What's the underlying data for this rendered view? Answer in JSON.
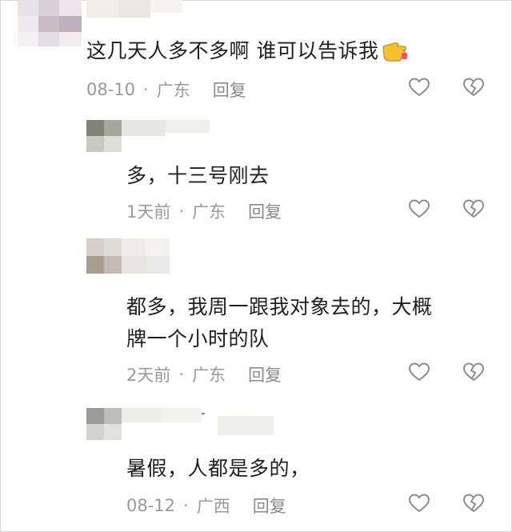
{
  "comments": [
    {
      "content": "这几天人多不多啊 谁可以告诉我",
      "emoji": "pointing-hand-emoji",
      "time": "08-10",
      "location": "广东",
      "reply_label": "回复"
    },
    {
      "content": "多，十三号刚去",
      "time": "1天前",
      "location": "广东",
      "reply_label": "回复"
    },
    {
      "content_line1": "都多，我周一跟我对象去的，大概",
      "content_line2": "牌一个小时的队",
      "time": "2天前",
      "location": "广东",
      "reply_label": "回复"
    },
    {
      "content": "暑假，人都是多的，",
      "time": "08-12",
      "location": "广西",
      "reply_label": "回复"
    }
  ],
  "separator": "·"
}
